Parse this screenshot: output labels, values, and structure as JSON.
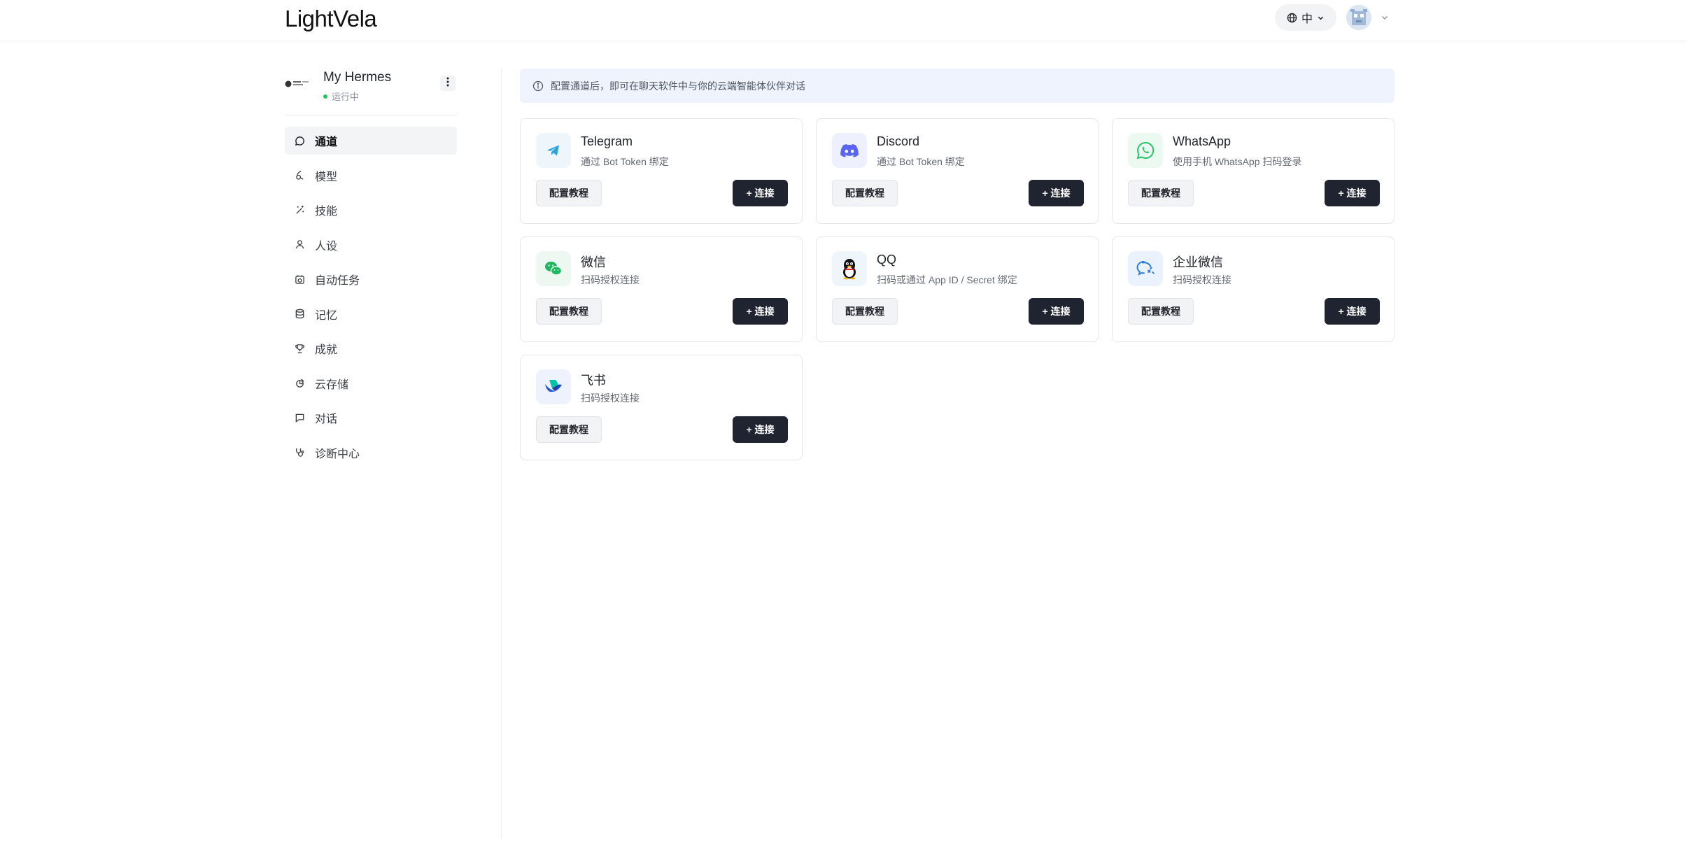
{
  "header": {
    "logo": "LightVela",
    "language_label": "中"
  },
  "sidebar": {
    "profile": {
      "name": "My Hermes",
      "status": "运行中"
    },
    "items": [
      {
        "label": "通道",
        "icon": "chat-bubble-icon",
        "active": true
      },
      {
        "label": "模型",
        "icon": "model-icon",
        "active": false
      },
      {
        "label": "技能",
        "icon": "magic-wand-icon",
        "active": false
      },
      {
        "label": "人设",
        "icon": "person-icon",
        "active": false
      },
      {
        "label": "自动任务",
        "icon": "calendar-clock-icon",
        "active": false
      },
      {
        "label": "记忆",
        "icon": "database-icon",
        "active": false
      },
      {
        "label": "成就",
        "icon": "trophy-icon",
        "active": false
      },
      {
        "label": "云存储",
        "icon": "cloud-storage-icon",
        "active": false
      },
      {
        "label": "对话",
        "icon": "message-icon",
        "active": false
      },
      {
        "label": "诊断中心",
        "icon": "stethoscope-icon",
        "active": false
      }
    ]
  },
  "main": {
    "banner_text": "配置通道后，即可在聊天软件中与你的云端智能体伙伴对话",
    "guide_label": "配置教程",
    "connect_label": "+ 连接",
    "channels": [
      {
        "title": "Telegram",
        "desc": "通过 Bot Token 绑定",
        "icon": "telegram-icon",
        "color": "#2aa3e0",
        "bg": "#eef6fc"
      },
      {
        "title": "Discord",
        "desc": "通过 Bot Token 绑定",
        "icon": "discord-icon",
        "color": "#5865f2",
        "bg": "#eff0fd"
      },
      {
        "title": "WhatsApp",
        "desc": "使用手机 WhatsApp 扫码登录",
        "icon": "whatsapp-icon",
        "color": "#25c466",
        "bg": "#ecf9f1"
      },
      {
        "title": "微信",
        "desc": "扫码授权连接",
        "icon": "wechat-icon",
        "color": "#1fb760",
        "bg": "#ecf8f0"
      },
      {
        "title": "QQ",
        "desc": "扫码或通过 App ID / Secret 绑定",
        "icon": "qq-penguin-icon",
        "color": "#111111",
        "bg": "#eef6fc"
      },
      {
        "title": "企业微信",
        "desc": "扫码授权连接",
        "icon": "wecom-icon",
        "color": "#2b7ed8",
        "bg": "#eaf3fd"
      },
      {
        "title": "飞书",
        "desc": "扫码授权连接",
        "icon": "feishu-icon",
        "color": "#2a5bd7",
        "bg": "#eef2fc"
      }
    ]
  }
}
